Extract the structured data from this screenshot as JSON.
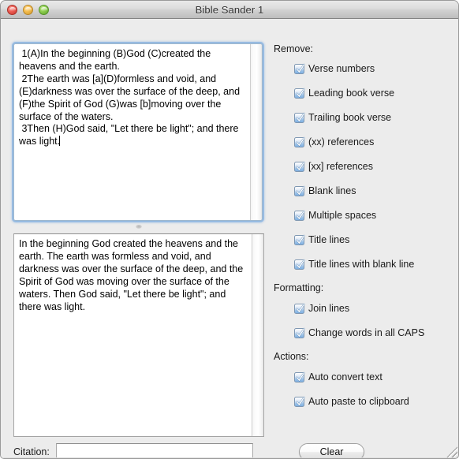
{
  "window": {
    "title": "Bible Sander 1",
    "controls": {
      "close": "close-button",
      "minimize": "minimize-button",
      "zoom": "zoom-button"
    },
    "accent_color": "#7fb0e2",
    "background_color": "#ececec"
  },
  "input_area": {
    "text": " 1(A)In the beginning (B)God (C)created the heavens and the earth.\n 2The earth was [a](D)formless and void, and (E)darkness was over the surface of the deep, and (F)the Spirit of God (G)was [b]moving over the surface of the waters.\n 3Then (H)God said, \"Let there be light\"; and there was light."
  },
  "output_area": {
    "text": "In the beginning God created the heavens and the earth. The earth was formless and void, and darkness was over the surface of the deep, and the Spirit of God was moving over the surface of the waters. Then God said, \"Let there be light\"; and there was light."
  },
  "options": {
    "remove": {
      "label": "Remove:",
      "items": [
        {
          "label": "Verse numbers",
          "checked": true
        },
        {
          "label": "Leading book verse",
          "checked": true
        },
        {
          "label": "Trailing book verse",
          "checked": true
        },
        {
          "label": "(xx) references",
          "checked": true
        },
        {
          "label": "[xx] references",
          "checked": true
        },
        {
          "label": "Blank lines",
          "checked": true
        },
        {
          "label": "Multiple spaces",
          "checked": true
        },
        {
          "label": "Title lines",
          "checked": true
        },
        {
          "label": "Title lines with blank line",
          "checked": true
        }
      ]
    },
    "formatting": {
      "label": "Formatting:",
      "items": [
        {
          "label": "Join lines",
          "checked": true
        },
        {
          "label": "Change words in all CAPS",
          "checked": true
        }
      ]
    },
    "actions": {
      "label": "Actions:",
      "items": [
        {
          "label": "Auto convert text",
          "checked": true
        },
        {
          "label": "Auto paste to clipboard",
          "checked": true
        }
      ]
    }
  },
  "footer": {
    "citation_label": "Citation:",
    "citation_value": "",
    "citation_placeholder": "",
    "clear_label": "Clear"
  }
}
